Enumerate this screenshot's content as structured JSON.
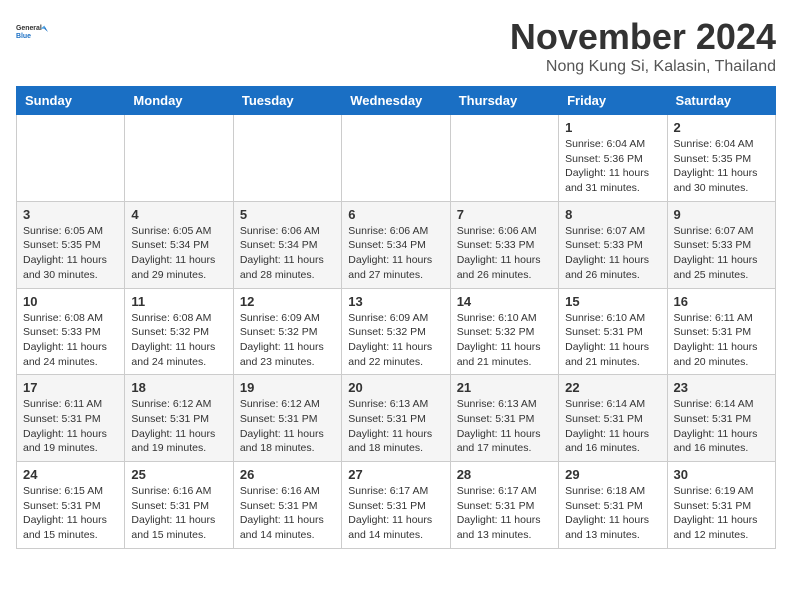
{
  "header": {
    "logo_general": "General",
    "logo_blue": "Blue",
    "month_title": "November 2024",
    "subtitle": "Nong Kung Si, Kalasin, Thailand"
  },
  "columns": [
    "Sunday",
    "Monday",
    "Tuesday",
    "Wednesday",
    "Thursday",
    "Friday",
    "Saturday"
  ],
  "weeks": [
    [
      {
        "day": "",
        "info": ""
      },
      {
        "day": "",
        "info": ""
      },
      {
        "day": "",
        "info": ""
      },
      {
        "day": "",
        "info": ""
      },
      {
        "day": "",
        "info": ""
      },
      {
        "day": "1",
        "info": "Sunrise: 6:04 AM\nSunset: 5:36 PM\nDaylight: 11 hours and 31 minutes."
      },
      {
        "day": "2",
        "info": "Sunrise: 6:04 AM\nSunset: 5:35 PM\nDaylight: 11 hours and 30 minutes."
      }
    ],
    [
      {
        "day": "3",
        "info": "Sunrise: 6:05 AM\nSunset: 5:35 PM\nDaylight: 11 hours and 30 minutes."
      },
      {
        "day": "4",
        "info": "Sunrise: 6:05 AM\nSunset: 5:34 PM\nDaylight: 11 hours and 29 minutes."
      },
      {
        "day": "5",
        "info": "Sunrise: 6:06 AM\nSunset: 5:34 PM\nDaylight: 11 hours and 28 minutes."
      },
      {
        "day": "6",
        "info": "Sunrise: 6:06 AM\nSunset: 5:34 PM\nDaylight: 11 hours and 27 minutes."
      },
      {
        "day": "7",
        "info": "Sunrise: 6:06 AM\nSunset: 5:33 PM\nDaylight: 11 hours and 26 minutes."
      },
      {
        "day": "8",
        "info": "Sunrise: 6:07 AM\nSunset: 5:33 PM\nDaylight: 11 hours and 26 minutes."
      },
      {
        "day": "9",
        "info": "Sunrise: 6:07 AM\nSunset: 5:33 PM\nDaylight: 11 hours and 25 minutes."
      }
    ],
    [
      {
        "day": "10",
        "info": "Sunrise: 6:08 AM\nSunset: 5:33 PM\nDaylight: 11 hours and 24 minutes."
      },
      {
        "day": "11",
        "info": "Sunrise: 6:08 AM\nSunset: 5:32 PM\nDaylight: 11 hours and 24 minutes."
      },
      {
        "day": "12",
        "info": "Sunrise: 6:09 AM\nSunset: 5:32 PM\nDaylight: 11 hours and 23 minutes."
      },
      {
        "day": "13",
        "info": "Sunrise: 6:09 AM\nSunset: 5:32 PM\nDaylight: 11 hours and 22 minutes."
      },
      {
        "day": "14",
        "info": "Sunrise: 6:10 AM\nSunset: 5:32 PM\nDaylight: 11 hours and 21 minutes."
      },
      {
        "day": "15",
        "info": "Sunrise: 6:10 AM\nSunset: 5:31 PM\nDaylight: 11 hours and 21 minutes."
      },
      {
        "day": "16",
        "info": "Sunrise: 6:11 AM\nSunset: 5:31 PM\nDaylight: 11 hours and 20 minutes."
      }
    ],
    [
      {
        "day": "17",
        "info": "Sunrise: 6:11 AM\nSunset: 5:31 PM\nDaylight: 11 hours and 19 minutes."
      },
      {
        "day": "18",
        "info": "Sunrise: 6:12 AM\nSunset: 5:31 PM\nDaylight: 11 hours and 19 minutes."
      },
      {
        "day": "19",
        "info": "Sunrise: 6:12 AM\nSunset: 5:31 PM\nDaylight: 11 hours and 18 minutes."
      },
      {
        "day": "20",
        "info": "Sunrise: 6:13 AM\nSunset: 5:31 PM\nDaylight: 11 hours and 18 minutes."
      },
      {
        "day": "21",
        "info": "Sunrise: 6:13 AM\nSunset: 5:31 PM\nDaylight: 11 hours and 17 minutes."
      },
      {
        "day": "22",
        "info": "Sunrise: 6:14 AM\nSunset: 5:31 PM\nDaylight: 11 hours and 16 minutes."
      },
      {
        "day": "23",
        "info": "Sunrise: 6:14 AM\nSunset: 5:31 PM\nDaylight: 11 hours and 16 minutes."
      }
    ],
    [
      {
        "day": "24",
        "info": "Sunrise: 6:15 AM\nSunset: 5:31 PM\nDaylight: 11 hours and 15 minutes."
      },
      {
        "day": "25",
        "info": "Sunrise: 6:16 AM\nSunset: 5:31 PM\nDaylight: 11 hours and 15 minutes."
      },
      {
        "day": "26",
        "info": "Sunrise: 6:16 AM\nSunset: 5:31 PM\nDaylight: 11 hours and 14 minutes."
      },
      {
        "day": "27",
        "info": "Sunrise: 6:17 AM\nSunset: 5:31 PM\nDaylight: 11 hours and 14 minutes."
      },
      {
        "day": "28",
        "info": "Sunrise: 6:17 AM\nSunset: 5:31 PM\nDaylight: 11 hours and 13 minutes."
      },
      {
        "day": "29",
        "info": "Sunrise: 6:18 AM\nSunset: 5:31 PM\nDaylight: 11 hours and 13 minutes."
      },
      {
        "day": "30",
        "info": "Sunrise: 6:19 AM\nSunset: 5:31 PM\nDaylight: 11 hours and 12 minutes."
      }
    ]
  ]
}
